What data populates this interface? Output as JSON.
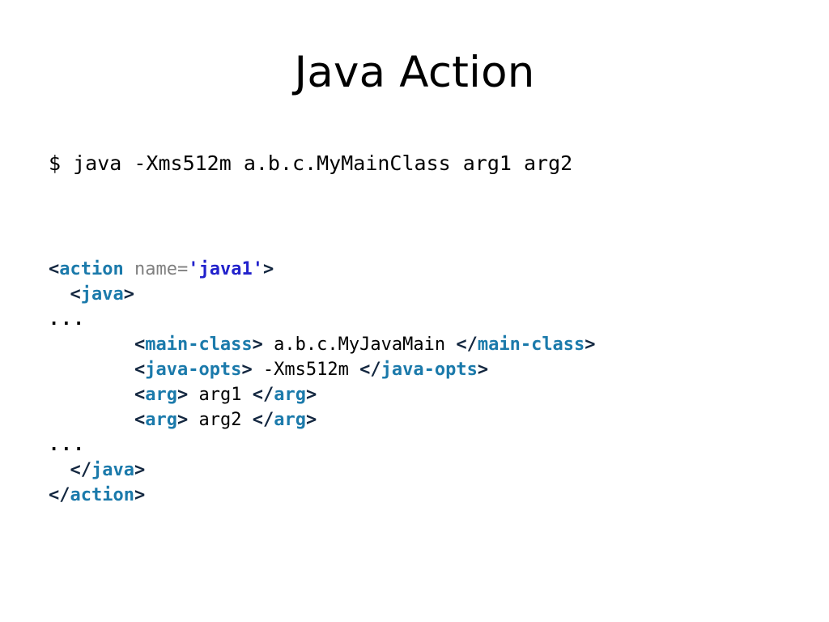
{
  "slide": {
    "title": "Java Action",
    "background_color": "#ffffff"
  },
  "command": {
    "text": "$ java -Xms512m a.b.c.MyMainClass arg1 arg2",
    "prompt": "$",
    "program": "java",
    "jvm_option": "-Xms512m",
    "main_class": "a.b.c.MyMainClass",
    "args": [
      "arg1",
      "arg2"
    ]
  },
  "colors": {
    "tag": "#1b7aab",
    "punctuation": "#12263f",
    "attribute_name": "#808080",
    "attribute_value": "#2222cc",
    "text": "#000000",
    "ellipsis": "#000000"
  },
  "code": {
    "language": "xml",
    "lines": [
      {
        "indent": "",
        "segments": [
          {
            "type": "punct",
            "text": "<"
          },
          {
            "type": "tag",
            "text": "action"
          },
          {
            "type": "attr",
            "text": " name"
          },
          {
            "type": "eq",
            "text": "="
          },
          {
            "type": "value",
            "text": "'java1'"
          },
          {
            "type": "punct",
            "text": ">"
          }
        ]
      },
      {
        "indent": "  ",
        "segments": [
          {
            "type": "punct",
            "text": "<"
          },
          {
            "type": "tag",
            "text": "java"
          },
          {
            "type": "punct",
            "text": ">"
          }
        ]
      },
      {
        "indent": "",
        "segments": [
          {
            "type": "ellipsis",
            "text": "..."
          }
        ]
      },
      {
        "indent": "        ",
        "segments": [
          {
            "type": "punct",
            "text": "<"
          },
          {
            "type": "tag",
            "text": "main-class"
          },
          {
            "type": "punct",
            "text": ">"
          },
          {
            "type": "text",
            "text": " a.b.c.MyJavaMain "
          },
          {
            "type": "punct",
            "text": "</"
          },
          {
            "type": "tag",
            "text": "main-class"
          },
          {
            "type": "punct",
            "text": ">"
          }
        ]
      },
      {
        "indent": "        ",
        "segments": [
          {
            "type": "punct",
            "text": "<"
          },
          {
            "type": "tag",
            "text": "java-opts"
          },
          {
            "type": "punct",
            "text": ">"
          },
          {
            "type": "text",
            "text": " -Xms512m "
          },
          {
            "type": "punct",
            "text": "</"
          },
          {
            "type": "tag",
            "text": "java-opts"
          },
          {
            "type": "punct",
            "text": ">"
          }
        ]
      },
      {
        "indent": "        ",
        "segments": [
          {
            "type": "punct",
            "text": "<"
          },
          {
            "type": "tag",
            "text": "arg"
          },
          {
            "type": "punct",
            "text": ">"
          },
          {
            "type": "text",
            "text": " arg1 "
          },
          {
            "type": "punct",
            "text": "</"
          },
          {
            "type": "tag",
            "text": "arg"
          },
          {
            "type": "punct",
            "text": ">"
          }
        ]
      },
      {
        "indent": "        ",
        "segments": [
          {
            "type": "punct",
            "text": "<"
          },
          {
            "type": "tag",
            "text": "arg"
          },
          {
            "type": "punct",
            "text": ">"
          },
          {
            "type": "text",
            "text": " arg2 "
          },
          {
            "type": "punct",
            "text": "</"
          },
          {
            "type": "tag",
            "text": "arg"
          },
          {
            "type": "punct",
            "text": ">"
          }
        ]
      },
      {
        "indent": "",
        "segments": [
          {
            "type": "ellipsis",
            "text": "..."
          }
        ]
      },
      {
        "indent": "  ",
        "segments": [
          {
            "type": "punct",
            "text": "</"
          },
          {
            "type": "tag",
            "text": "java"
          },
          {
            "type": "punct",
            "text": ">"
          }
        ]
      },
      {
        "indent": "",
        "segments": [
          {
            "type": "punct",
            "text": "</"
          },
          {
            "type": "tag",
            "text": "action"
          },
          {
            "type": "punct",
            "text": ">"
          }
        ]
      }
    ]
  }
}
